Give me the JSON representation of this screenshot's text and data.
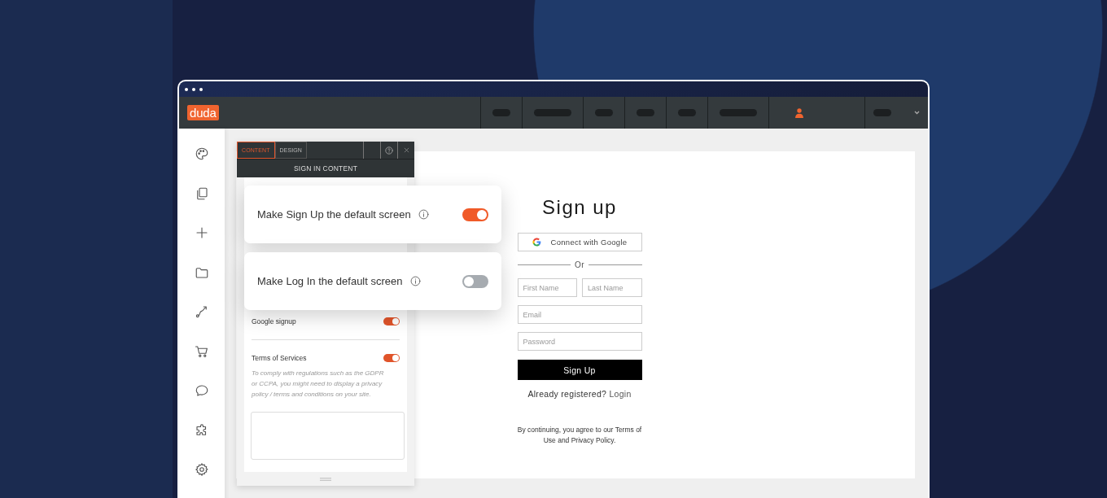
{
  "topbar": {
    "logo": "duda"
  },
  "panel": {
    "tabs": [
      {
        "label": "CONTENT",
        "selected": true
      },
      {
        "label": "DESIGN",
        "selected": false
      }
    ],
    "title": "SIGN IN CONTENT",
    "settings": [
      {
        "label": "Google signup",
        "on": true
      },
      {
        "label": "Terms of Services",
        "on": true,
        "note": "To comply with regulations such as the GDPR or CCPA, you might need to display a privacy policy / terms and conditions on your site."
      }
    ]
  },
  "callouts": [
    {
      "label": "Make Sign Up the default screen",
      "on": true
    },
    {
      "label": "Make Log In the default screen",
      "on": false
    }
  ],
  "signup_form": {
    "title": "Sign up",
    "google_button": "Connect with Google",
    "divider": "Or",
    "field_rows": [
      {
        "fields": [
          {
            "placeholder": "First Name"
          },
          {
            "placeholder": "Last Name"
          }
        ]
      },
      {
        "fields": [
          {
            "placeholder": "Email"
          }
        ]
      },
      {
        "fields": [
          {
            "placeholder": "Password"
          }
        ]
      }
    ],
    "submit": "Sign Up",
    "login_prompt": "Already registered?",
    "login_link": "Login",
    "legal": "By continuing, you agree to our Terms of Use and Privacy Policy."
  }
}
